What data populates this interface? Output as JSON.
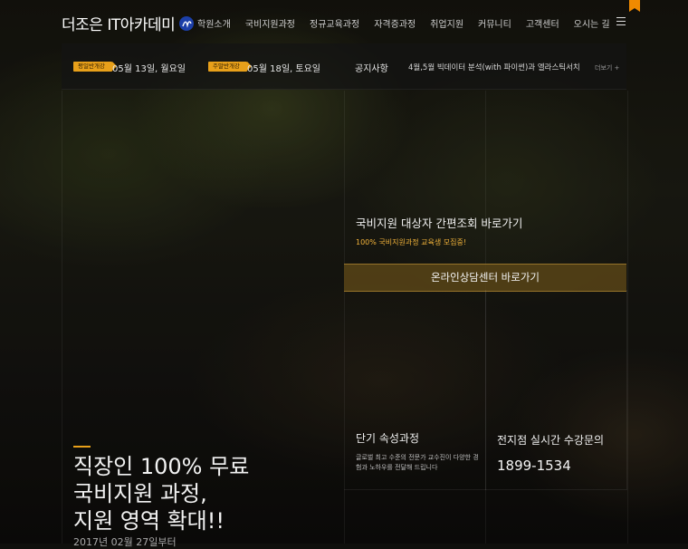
{
  "header": {
    "logo_text": "더조은 IT아카데미",
    "nav": [
      "학원소개",
      "국비지원과정",
      "정규교육과정",
      "자격증과정",
      "취업지원",
      "커뮤니티",
      "고객센터",
      "오시는 길"
    ]
  },
  "notice_bar": {
    "weekday_badge": "평일반개강",
    "weekday_date": "05월 13일, 월요일",
    "weekend_badge": "주말반개강",
    "weekend_date": "05월 18일, 토요일",
    "notice_label": "공지사항",
    "notice_text": "4월,5월 빅데이터 분석(with 파이썬)과 엘라스틱서치",
    "more_label": "더보기 +"
  },
  "promo": {
    "title": "국비지원 대상자 간편조회 바로가기",
    "subtitle": "100% 국비지원과정 교육생 모집중!",
    "consult_button": "온라인상담센터 바로가기"
  },
  "short_course": {
    "title": "단기 속성과정",
    "desc": "글로벌 최고 수준의 전문가 교수진이 다양한 경험과 노하우를 전달해 드립니다"
  },
  "inquiry": {
    "title": "전지점 실시간 수강문의",
    "phone": "1899-1534"
  },
  "headline": {
    "line1": "직장인 100% 무료",
    "line2": "국비지원 과정,",
    "line3": "지원 영역 확대!!",
    "date": "2017년 02월 27일부터"
  },
  "colors": {
    "accent": "#e8a01a",
    "consult_bg": "#584416"
  }
}
